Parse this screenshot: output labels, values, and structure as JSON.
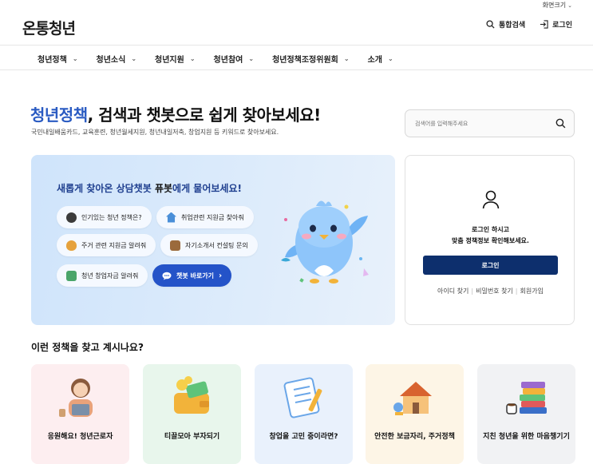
{
  "topbar": {
    "font_size_label": "화면크기"
  },
  "header": {
    "logo": "온통청년",
    "search_label": "통합검색",
    "login_label": "로그인"
  },
  "gnb": {
    "items": [
      {
        "label": "청년정책"
      },
      {
        "label": "청년소식"
      },
      {
        "label": "청년지원"
      },
      {
        "label": "청년참여"
      },
      {
        "label": "청년정책조정위원회"
      },
      {
        "label": "소개"
      }
    ]
  },
  "hero": {
    "title_accent": "청년정책",
    "title_rest": ", 검색과 챗봇으로 쉽게 찾아보세요!",
    "subtitle": "국민내일배움카드, 교육훈련, 청년월세지원, 청년내일저축, 창업지원 등 키워드로 찾아보세요.",
    "search_placeholder": "검색어를 입력해주세요"
  },
  "chatbot": {
    "title_pre": "새롭게 찾아온 상담챗봇 ",
    "title_name": "퓨봇",
    "title_post": "에게 물어보세요!",
    "chips": [
      {
        "label": "인기있는 청년 정책은?",
        "icon": "person-icon",
        "color": "#3b3b3b"
      },
      {
        "label": "취업관련 지원금 찾아줘",
        "icon": "house-icon",
        "color": "#4a8fd8"
      },
      {
        "label": "주거 관련 지원금 알려줘",
        "icon": "money-bag-icon",
        "color": "#e6a23c"
      },
      {
        "label": "자기소개서 컨설팅 문의",
        "icon": "briefcase-icon",
        "color": "#9b6a3c"
      },
      {
        "label": "청년 창업자금 알려줘",
        "icon": "books-icon",
        "color": "#4aa56a"
      }
    ],
    "cta_label": "챗봇 바로가기"
  },
  "login": {
    "message_line1": "로그인 하시고",
    "message_line2": "맞춤 정책정보 확인해보세요.",
    "button_label": "로그인",
    "links": [
      "아이디 찾기",
      "비밀번호 찾기",
      "회원가입"
    ]
  },
  "recommend": {
    "title": "이런 정책을 찾고 계시나요?",
    "cards": [
      {
        "label": "응원해요! 청년근로자",
        "bg": "#fdeef0"
      },
      {
        "label": "티끌모아 부자되기",
        "bg": "#e8f6ec"
      },
      {
        "label": "창업을 고민 중이라면?",
        "bg": "#e9f1fc"
      },
      {
        "label": "안전한 보금자리, 주거정책",
        "bg": "#fdf5e6"
      },
      {
        "label": "지친 청년을 위한 마음챙기기",
        "bg": "#f1f2f4"
      }
    ]
  },
  "colors": {
    "accent": "#2a5bc2",
    "navy": "#0d2f6d",
    "cta": "#2453c8"
  }
}
